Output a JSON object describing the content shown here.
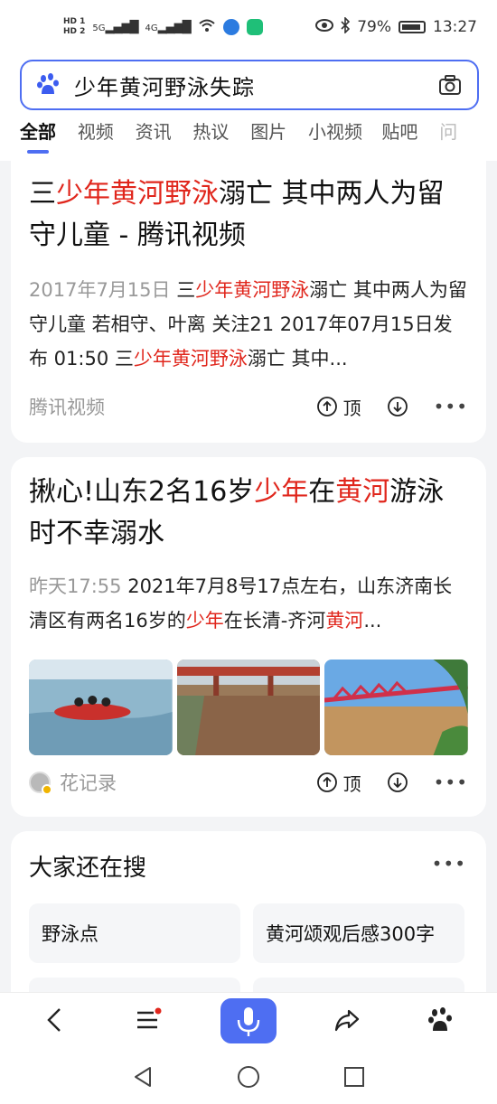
{
  "status_bar": {
    "hd1": "HD 1",
    "hd2": "HD 2",
    "net1": "5G",
    "net2": "4G",
    "battery": "79%",
    "time": "13:27"
  },
  "search": {
    "query": "少年黄河野泳失踪",
    "logo_icon": "baidu-paw-icon",
    "camera_icon": "camera-icon"
  },
  "tabs": [
    "全部",
    "视频",
    "资讯",
    "热议",
    "图片",
    "小视频",
    "贴吧",
    "问"
  ],
  "results": [
    {
      "title_parts": [
        {
          "t": "三",
          "hl": false
        },
        {
          "t": "少年黄河野泳",
          "hl": true
        },
        {
          "t": "溺亡 其中两人为留守儿童 - 腾讯视频",
          "hl": false
        }
      ],
      "date": "2017年7月15日",
      "snippet_parts": [
        {
          "t": "三",
          "hl": false
        },
        {
          "t": "少年黄河野泳",
          "hl": true
        },
        {
          "t": "溺亡 其中两人为留守儿童 若相守、叶离 关注21 2017年07月15日发布 01:50 三",
          "hl": false
        },
        {
          "t": "少年黄河野泳",
          "hl": true
        },
        {
          "t": "溺亡 其中...",
          "hl": false
        }
      ],
      "source": "腾讯视频",
      "up_label": "顶"
    },
    {
      "title_parts": [
        {
          "t": "揪心!山东2名16岁",
          "hl": false
        },
        {
          "t": "少年",
          "hl": true
        },
        {
          "t": "在",
          "hl": false
        },
        {
          "t": "黄河",
          "hl": true
        },
        {
          "t": "游泳时不幸溺水",
          "hl": false
        }
      ],
      "date": "昨天17:55",
      "snippet_parts": [
        {
          "t": "2021年7月8号17点左右，山东济南长清区有两名16岁的",
          "hl": false
        },
        {
          "t": "少年",
          "hl": true
        },
        {
          "t": "在长清-齐河",
          "hl": false
        },
        {
          "t": "黄河",
          "hl": true
        },
        {
          "t": "...",
          "hl": false
        }
      ],
      "source": "花记录",
      "up_label": "顶"
    }
  ],
  "related": {
    "title": "大家还在搜",
    "items": [
      "野泳点",
      "黄河颂观后感300字"
    ]
  },
  "colors": {
    "accent": "#4e6ef2",
    "highlight": "#e0261c"
  }
}
